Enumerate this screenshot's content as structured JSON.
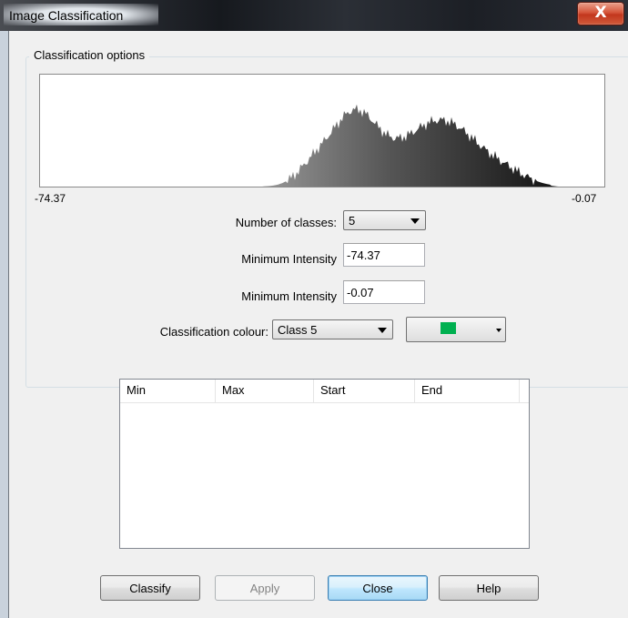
{
  "window": {
    "title": "Image Classification",
    "close_glyph": "X"
  },
  "options": {
    "group_label": "Classification options",
    "histogram": {
      "min_label": "-74.37",
      "max_label": "-0.07"
    },
    "num_classes_label": "Number of classes:",
    "num_classes_value": "5",
    "min_intensity_label": "Minimum Intensity",
    "min_intensity_value": "-74.37",
    "max_intensity_label": "Minimum Intensity",
    "max_intensity_value": "-0.07",
    "colour_label": "Classification colour:",
    "colour_class_value": "Class 5",
    "colour_swatch": "#00b050"
  },
  "table": {
    "columns": [
      "Min",
      "Max",
      "Start",
      "End"
    ],
    "rows": []
  },
  "buttons": {
    "classify": "Classify",
    "apply": "Apply",
    "close": "Close",
    "help": "Help"
  }
}
